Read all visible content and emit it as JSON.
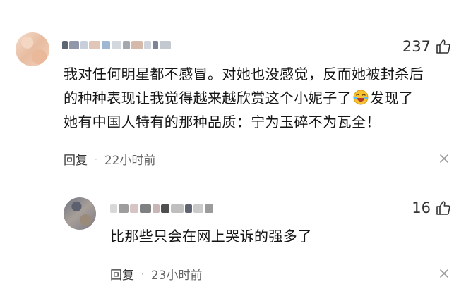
{
  "comments": {
    "main": {
      "likes": "237",
      "lines": [
        "我对任何明星都不感冒。对她也没感觉，反而她被封杀后",
        "的种种表现让我觉得越来越欣赏这个小妮子了",
        "发现了",
        "她有中国人特有的那种品质：宁为玉碎不为瓦全！"
      ],
      "reply_label": "回复",
      "time": "22小时前"
    },
    "reply": {
      "likes": "16",
      "text": "比那些只会在网上哭诉的强多了",
      "reply_label": "回复",
      "time": "23小时前"
    }
  },
  "icons": {
    "like": "thumb-up-icon",
    "emoji": "laughing-crying-face-icon",
    "more": "close-icon"
  },
  "colors": {
    "text_primary": "#151515",
    "text_secondary": "#666666",
    "background": "#ffffff"
  }
}
